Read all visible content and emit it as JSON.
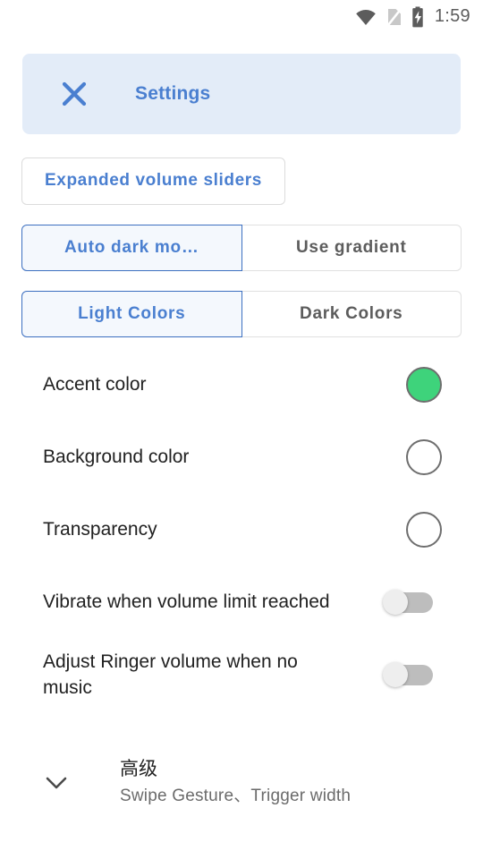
{
  "statusbar": {
    "icons": [
      "wifi-icon",
      "no-sim-icon",
      "battery-charging-icon"
    ],
    "time": "1:59"
  },
  "header": {
    "close_icon": "close-icon",
    "title": "Settings",
    "background": "#e3ecf8",
    "accent": "#4a7fd0"
  },
  "buttons": {
    "expanded_volume_sliders": "Expanded volume sliders"
  },
  "segmented_groups": [
    {
      "name": "dark-mode-group",
      "options": [
        {
          "label": "Auto dark mo…",
          "selected": true
        },
        {
          "label": "Use gradient",
          "selected": false
        }
      ]
    },
    {
      "name": "colors-group",
      "options": [
        {
          "label": "Light Colors",
          "selected": true
        },
        {
          "label": "Dark Colors",
          "selected": false
        }
      ]
    }
  ],
  "rows": [
    {
      "label": "Accent color",
      "control": "swatch",
      "color": "#3ed37b"
    },
    {
      "label": "Background color",
      "control": "swatch",
      "color": "#ffffff"
    },
    {
      "label": "Transparency",
      "control": "swatch",
      "color": "#ffffff"
    },
    {
      "label": "Vibrate when volume limit reached",
      "control": "toggle",
      "value": "off"
    },
    {
      "label": "Adjust Ringer volume when no music",
      "control": "toggle",
      "value": "off"
    }
  ],
  "advanced": {
    "icon": "chevron-down-icon",
    "title": "高级",
    "subtitle": "Swipe Gesture、Trigger width"
  }
}
